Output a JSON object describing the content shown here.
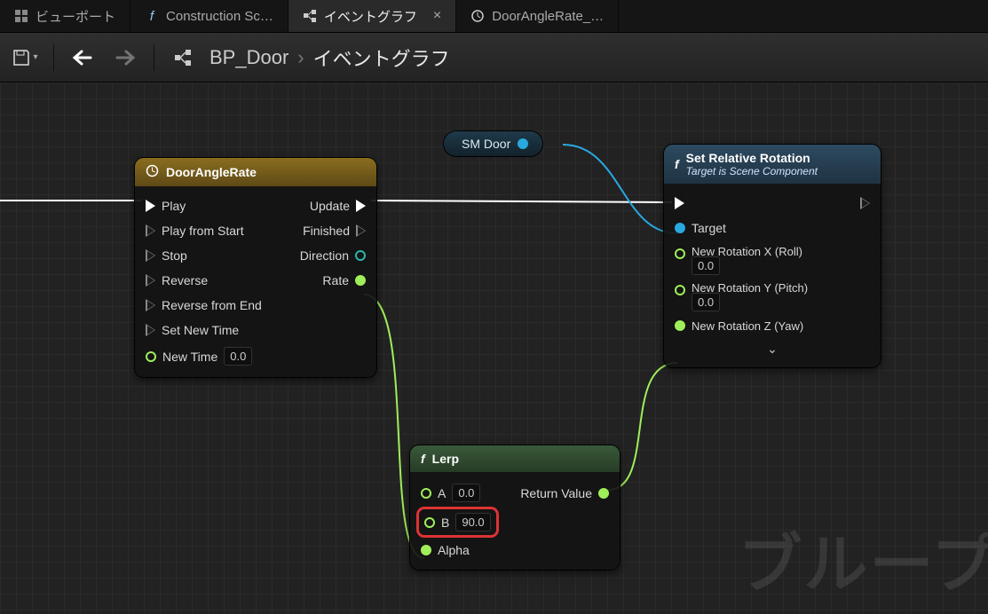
{
  "tabs": [
    {
      "label": "ビューポート",
      "icon": "viewport"
    },
    {
      "label": "Construction Sc…",
      "icon": "func"
    },
    {
      "label": "イベントグラフ",
      "icon": "graph",
      "active": true,
      "closable": true
    },
    {
      "label": "DoorAngleRate_…",
      "icon": "timeline"
    }
  ],
  "toolbar": {
    "save_icon": "save",
    "breadcrumb_root": "BP_Door",
    "breadcrumb_leaf": "イベントグラフ"
  },
  "watermark": "ブループ",
  "var_node": {
    "label": "SM Door"
  },
  "timeline_node": {
    "title": "DoorAngleRate",
    "inputs": {
      "play": "Play",
      "play_from_start": "Play from Start",
      "stop": "Stop",
      "reverse": "Reverse",
      "reverse_from_end": "Reverse from End",
      "set_new_time": "Set New Time",
      "new_time_label": "New Time",
      "new_time_value": "0.0"
    },
    "outputs": {
      "update": "Update",
      "finished": "Finished",
      "direction": "Direction",
      "rate": "Rate"
    }
  },
  "lerp_node": {
    "title": "Lerp",
    "a_label": "A",
    "a_value": "0.0",
    "b_label": "B",
    "b_value": "90.0",
    "alpha_label": "Alpha",
    "return_label": "Return Value"
  },
  "setrot_node": {
    "title": "Set Relative Rotation",
    "subtitle": "Target is Scene Component",
    "target_label": "Target",
    "roll_label": "New Rotation X (Roll)",
    "roll_value": "0.0",
    "pitch_label": "New Rotation Y (Pitch)",
    "pitch_value": "0.0",
    "yaw_label": "New Rotation Z (Yaw)"
  }
}
